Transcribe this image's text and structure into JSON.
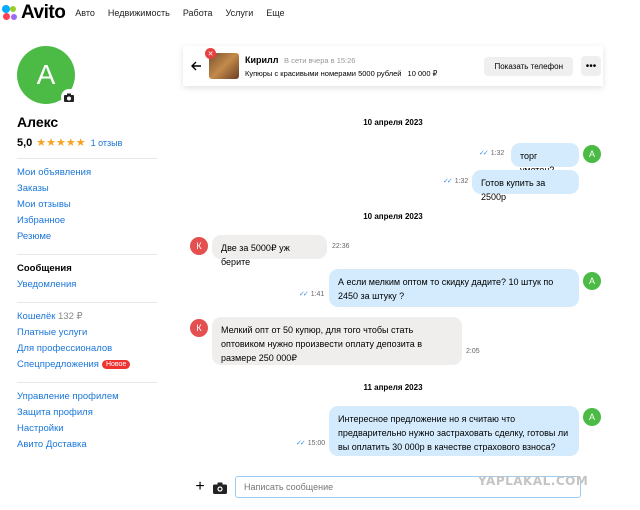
{
  "brand": {
    "name": "Avito"
  },
  "nav": [
    "Авто",
    "Недвижимость",
    "Работа",
    "Услуги",
    "Еще"
  ],
  "profile": {
    "initial": "А",
    "name": "Алекс",
    "rating": "5,0",
    "stars": "★★★★★",
    "reviews": "1 отзыв",
    "menu_group_1": [
      "Мои объявления",
      "Заказы",
      "Мои отзывы",
      "Избранное",
      "Резюме"
    ],
    "menu_group_2": {
      "active": "Сообщения",
      "notifications": "Уведомления"
    },
    "wallet": {
      "label": "Кошелёк",
      "amount": "132 ₽"
    },
    "menu_group_3": [
      "Платные услуги",
      "Для профессионалов"
    ],
    "special": {
      "label": "Спецпредложения",
      "badge": "Новое"
    },
    "menu_group_4": [
      "Управление профилем",
      "Защита профиля",
      "Настройки",
      "Авито Доставка"
    ]
  },
  "chat": {
    "seller_name": "Кирилл",
    "seller_status": "В сети вчера в 15:26",
    "ad_title": "Купюры с красивыми номерами 5000 рублей",
    "ad_price": "10 000 ₽",
    "phone_button": "Показать телефон",
    "more_button": "•••",
    "seller_initial": "К",
    "user_initial": "А",
    "dates": [
      "10 апреля 2023",
      "10 апреля 2023",
      "11 апреля 2023"
    ],
    "messages": [
      {
        "dir": "out",
        "text": "торг уметен?",
        "time": "1:32"
      },
      {
        "dir": "out",
        "text": "Готов купить за 2500р",
        "time": "1:32"
      },
      {
        "dir": "in",
        "text": "Две за 5000₽ уж берите",
        "time": "22:36"
      },
      {
        "dir": "out",
        "text": "А если мелким оптом то скидку дадите? 10 штук по 2450 за штуку ?",
        "time": "1:41"
      },
      {
        "dir": "in",
        "text": "Мелкий опт от 50 купюр, для того чтобы стать оптовиком нужно произвести оплату депозита в размере 250 000₽",
        "time": "2:05"
      },
      {
        "dir": "out",
        "text": "Интересное предложение но я считаю что предварительно нужно застраховать сделку, готовы ли вы оплатить 30 000р в качестве страхового взноса?",
        "time": "15:00"
      }
    ],
    "input_placeholder": "Написать сообщение"
  },
  "watermark": "YAPLAKAL.COM"
}
